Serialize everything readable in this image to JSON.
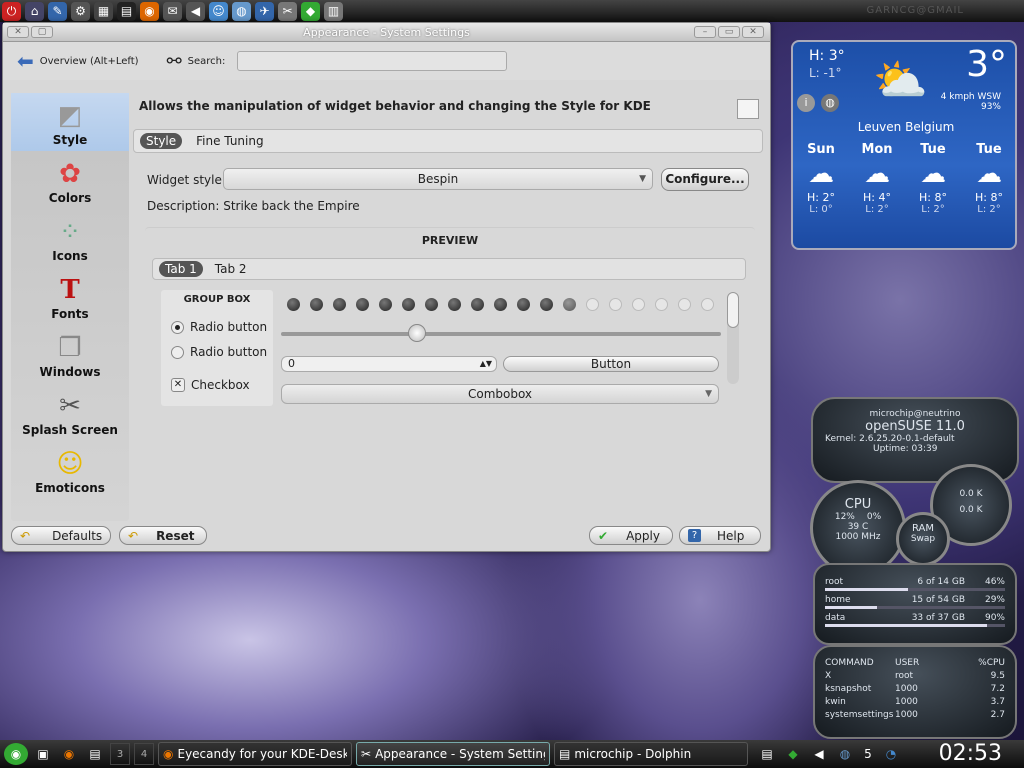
{
  "top_panel": {
    "watermark": "GARNCG@GMAIL"
  },
  "window": {
    "title": "Appearance - System Settings",
    "toolbar": {
      "back_label": "Overview (Alt+Left)",
      "search_label": "Search:",
      "search_value": ""
    },
    "sidebar": [
      {
        "label": "Style",
        "icon": "style-icon"
      },
      {
        "label": "Colors",
        "icon": "colors-icon"
      },
      {
        "label": "Icons",
        "icon": "icons-icon"
      },
      {
        "label": "Fonts",
        "icon": "fonts-icon"
      },
      {
        "label": "Windows",
        "icon": "windows-icon"
      },
      {
        "label": "Splash Screen",
        "icon": "splash-icon"
      },
      {
        "label": "Emoticons",
        "icon": "emoticons-icon"
      }
    ],
    "main": {
      "description": "Allows the manipulation of widget behavior and changing the Style for KDE",
      "tabs": [
        "Style",
        "Fine Tuning"
      ],
      "widget_style_label": "Widget style:",
      "widget_style_value": "Bespin",
      "configure_label": "Configure...",
      "description_row": "Description: Strike back the Empire",
      "preview": {
        "title": "PREVIEW",
        "tabs": [
          "Tab 1",
          "Tab 2"
        ],
        "group_box_title": "GROUP BOX",
        "radio1": "Radio button",
        "radio2": "Radio button",
        "checkbox": "Checkbox",
        "progress_filled": 13,
        "progress_total": 19,
        "slider_fraction": 0.31,
        "spin_value": "0",
        "button_label": "Button",
        "combo_label": "Combobox"
      }
    },
    "buttons": {
      "defaults": "Defaults",
      "reset": "Reset",
      "apply": "Apply",
      "help": "Help"
    }
  },
  "weather": {
    "high": "H: 3°",
    "low": "L: -1°",
    "temp": "3°",
    "wind": "4 kmph WSW",
    "humidity": "93%",
    "location": "Leuven  Belgium",
    "days": [
      {
        "day": "Sun",
        "high": "H: 2°",
        "low": "L: 0°"
      },
      {
        "day": "Mon",
        "high": "H: 4°",
        "low": "L: 2°"
      },
      {
        "day": "Tue",
        "high": "H: 8°",
        "low": "L: 2°"
      },
      {
        "day": "Tue",
        "high": "H: 8°",
        "low": "L: 2°"
      }
    ]
  },
  "sysmon": {
    "host": "microchip@neutrino",
    "os": "openSUSE 11.0",
    "kernel": "Kernel: 2.6.25.20-0.1-default",
    "uptime": "Uptime:    03:39",
    "cpu_label": "CPU",
    "cpu1": "12%",
    "cpu2": "0%",
    "cpu_temp": "39 C",
    "cpu_freq": "1000 MHz",
    "net_down": "0.0 K",
    "net_up": "0.0 K",
    "ram_label": "RAM",
    "swap_label": "Swap",
    "disks": [
      {
        "name": "root",
        "usage": "6 of 14 GB",
        "pct": "46%",
        "fraction": 0.46
      },
      {
        "name": "home",
        "usage": "15 of 54 GB",
        "pct": "29%",
        "fraction": 0.29
      },
      {
        "name": "data",
        "usage": "33 of 37 GB",
        "pct": "90%",
        "fraction": 0.9
      }
    ],
    "proc_headers": [
      "COMMAND",
      "USER",
      "%CPU"
    ],
    "procs": [
      [
        "X",
        "root",
        "9.5"
      ],
      [
        "ksnapshot",
        "1000",
        "7.2"
      ],
      [
        "kwin",
        "1000",
        "3.7"
      ],
      [
        "systemsettings",
        "1000",
        "2.7"
      ]
    ]
  },
  "taskbar": {
    "desktops": [
      "3",
      "4"
    ],
    "tasks": [
      "Eyecandy for your KDE-Deskto",
      "Appearance - System Settings",
      "microchip - Dolphin"
    ],
    "tray_count": "5",
    "clock": "02:53"
  },
  "colors": {
    "accent": "#3a6ab8",
    "weather_bg": "#2e66c4"
  }
}
